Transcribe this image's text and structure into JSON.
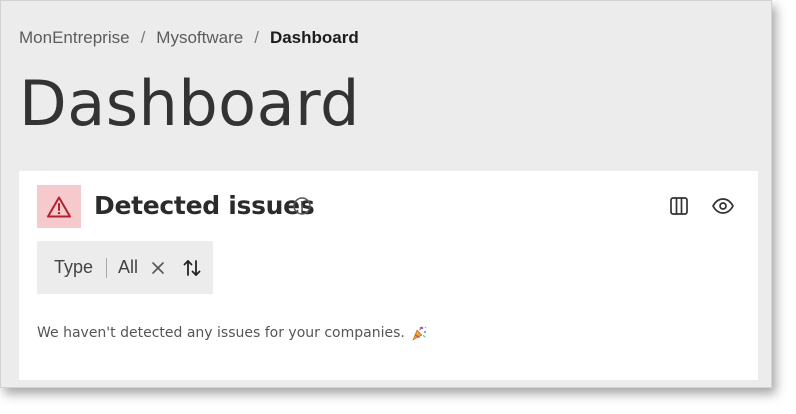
{
  "breadcrumb": {
    "items": [
      "MonEntreprise",
      "Mysoftware",
      "Dashboard"
    ],
    "separator": "/"
  },
  "page": {
    "title": "Dashboard"
  },
  "card": {
    "title": "Detected issues",
    "icons": [
      "warning-icon",
      "info-icon",
      "columns-icon",
      "eye-icon"
    ],
    "filter": {
      "label": "Type",
      "value": "All"
    },
    "empty_message": "We haven't detected any issues for your companies."
  },
  "colors": {
    "background": "#ececec",
    "card": "#ffffff",
    "warning_bg": "#f6c9cc",
    "warning_fg": "#b3202e",
    "text_dark": "#2b2b2b"
  }
}
